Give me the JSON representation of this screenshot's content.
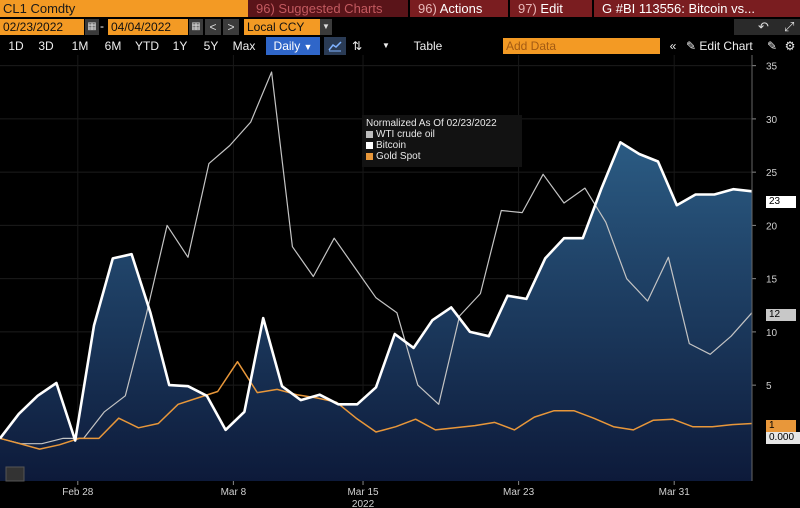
{
  "topbar": {
    "ticker": "CL1 Comdty",
    "suggested": "96) Suggested Charts",
    "actions_num": "96)",
    "actions": "Actions",
    "edit_num": "97)",
    "edit": "Edit",
    "g_label": "G #BI 113556: Bitcoin vs..."
  },
  "daterow": {
    "start_date": "02/23/2022",
    "dash": "-",
    "end_date": "04/04/2022",
    "prev_icon": "<",
    "next_icon": ">",
    "currency": "Local CCY"
  },
  "toolbar": {
    "periods": [
      "1D",
      "3D",
      "1M",
      "6M",
      "YTD",
      "1Y",
      "5Y",
      "Max"
    ],
    "frequency": "Daily",
    "table": "Table",
    "add_data_placeholder": "Add Data",
    "edit_chart": "Edit Chart"
  },
  "legend": {
    "title": "Normalized As Of 02/23/2022",
    "items": [
      {
        "label": "WTI crude oil",
        "color": "#bdbdbd"
      },
      {
        "label": "Bitcoin",
        "color": "#ffffff"
      },
      {
        "label": "Gold Spot",
        "color": "#e8973a"
      }
    ]
  },
  "tags": {
    "bitcoin": "23",
    "wti": "12",
    "gold": "1",
    "zero": "0.000"
  },
  "colors": {
    "accent_orange": "#f39a24",
    "dark_red": "#7a1d20",
    "blue_button": "#2f66c9",
    "area_fill": "#1b3f68"
  },
  "chart_data": {
    "type": "line",
    "title": "Normalized As Of 02/23/2022",
    "xlabel": "2022",
    "ylabel": "",
    "x_tick_labels": [
      "Feb 28",
      "Mar 8",
      "Mar 15",
      "Mar 23",
      "Mar 31"
    ],
    "x_tick_index": [
      3,
      9,
      14,
      20,
      26
    ],
    "y_tick_labels": [
      "5",
      "10",
      "15",
      "20",
      "25",
      "30",
      "35"
    ],
    "ylim": [
      -4,
      36
    ],
    "xlim": [
      0,
      29
    ],
    "grid": true,
    "series": [
      {
        "name": "Bitcoin",
        "style": "area",
        "values": [
          0.0,
          2.3,
          4.0,
          5.2,
          -0.2,
          10.6,
          16.9,
          17.3,
          11.8,
          5.0,
          4.9,
          4.0,
          0.8,
          2.5,
          11.3,
          4.9,
          3.6,
          4.1,
          3.2,
          3.2,
          4.8,
          9.8,
          8.5,
          11.1,
          12.3,
          10.0,
          9.6,
          13.4,
          13.1,
          16.9,
          18.8,
          18.8,
          23.5,
          27.8,
          26.7,
          26.0,
          21.9,
          22.9,
          22.9,
          23.4,
          23.2
        ]
      },
      {
        "name": "WTI crude oil",
        "style": "line",
        "values": [
          0.0,
          -0.5,
          -0.5,
          0.0,
          0.0,
          2.5,
          4.0,
          11.6,
          20.0,
          17.0,
          25.8,
          27.5,
          29.7,
          34.4,
          18.0,
          15.2,
          18.8,
          16.0,
          13.2,
          11.8,
          5.0,
          3.2,
          11.5,
          13.6,
          21.4,
          21.2,
          24.8,
          22.1,
          23.5,
          20.3,
          15.0,
          12.9,
          17.0,
          8.9,
          7.9,
          9.6,
          11.8
        ]
      },
      {
        "name": "Gold Spot",
        "style": "line",
        "values": [
          0.0,
          -0.5,
          -1.0,
          -0.6,
          0.0,
          0.0,
          1.9,
          1.0,
          1.4,
          3.2,
          3.8,
          4.4,
          7.2,
          4.3,
          4.6,
          4.1,
          3.8,
          3.4,
          1.9,
          0.6,
          1.1,
          1.8,
          0.8,
          1.0,
          1.2,
          1.5,
          0.8,
          2.0,
          2.6,
          2.6,
          1.9,
          1.1,
          0.8,
          1.7,
          1.8,
          1.1,
          1.1,
          1.3,
          1.4
        ]
      }
    ]
  }
}
